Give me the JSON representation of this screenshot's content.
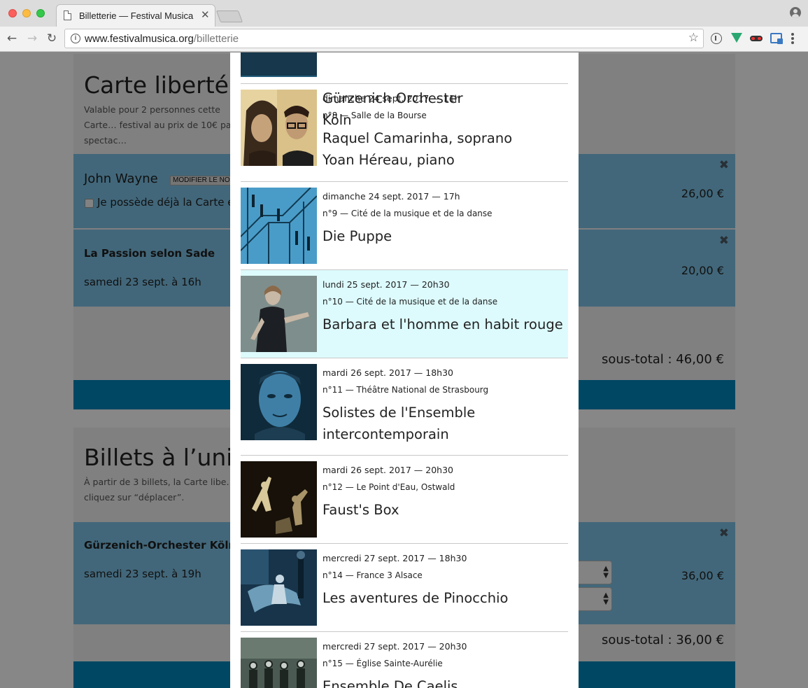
{
  "browser": {
    "tab_title": "Billetterie — Festival Musica",
    "tab_close": "✕",
    "url_host": "www.festivalmusica.org",
    "url_path": "/billetterie",
    "back": "←",
    "forward": "→",
    "reload": "↻",
    "star": "☆"
  },
  "page": {
    "carte": {
      "title": "Carte liberté",
      "description": "Valable pour 2 personnes cette Carte… festival au prix de 10€ par spectac…",
      "holder": {
        "name": "John Wayne",
        "modify_label": "MODIFIER LE NO",
        "checkbox_label": "Je possède déjà la Carte e",
        "price": "26,00 €"
      },
      "item": {
        "title": "La Passion selon Sade",
        "date": "samedi 23 sept. à 16h",
        "price": "20,00 €"
      },
      "subtotal": "sous-total : 46,00 €"
    },
    "billets": {
      "title": "Billets à l’unit",
      "description": "À partir de 3 billets, la Carte libe… cliquez sur “déplacer”.",
      "item": {
        "title": "Gürzenich-Orchester Köln",
        "date": "samedi 23 sept. à 19h",
        "price": "36,00 €"
      },
      "subtotal": "sous-total : 36,00 €"
    },
    "close_icon": "✖"
  },
  "modal": {
    "top_partial_title": "Gürzenich Orchester Köln",
    "events": [
      {
        "date": "dimanche 24 sept. 2017 — 11h",
        "venue": "n°8 — Salle de la Bourse",
        "title_lines": [
          "Raquel Camarinha, soprano",
          "Yoan Héreau, piano"
        ],
        "image": "portrait-duo-photo"
      },
      {
        "date": "dimanche 24 sept. 2017 — 17h",
        "venue": "n°9 — Cité de la musique et de la danse",
        "title_lines": [
          "Die Puppe"
        ],
        "image": "staircase-photo"
      },
      {
        "date": "lundi 25 sept. 2017 — 20h30",
        "venue": "n°10 — Cité de la musique et de la danse",
        "title_lines": [
          "Barbara et l'homme en habit rouge"
        ],
        "image": "singer-photo"
      },
      {
        "date": "mardi 26 sept. 2017 — 18h30",
        "venue": "n°11 — Théâtre National de Strasbourg",
        "title_lines": [
          "Solistes de l'Ensemble",
          "intercontemporain"
        ],
        "image": "man-portrait-photo"
      },
      {
        "date": "mardi 26 sept. 2017 — 20h30",
        "venue": "n°12 — Le Point d'Eau, Ostwald",
        "title_lines": [
          "Faust's Box"
        ],
        "image": "dancers-photo"
      },
      {
        "date": "mercredi 27 sept. 2017 — 18h30",
        "venue": "n°14 — France 3 Alsace",
        "title_lines": [
          "Les aventures de Pinocchio"
        ],
        "image": "stage-photo"
      },
      {
        "date": "mercredi 27 sept. 2017 — 20h30",
        "venue": "n°15 — Église Sainte-Aurélie",
        "title_lines": [
          "Ensemble De Caelis"
        ],
        "image": "ensemble-photo"
      }
    ]
  },
  "colors": {
    "item_blue": "#7ec3e7",
    "cta_blue": "#0086bb",
    "selected_row": "#ddfbfd",
    "overlay": "rgba(0,0,0,0.47)"
  }
}
